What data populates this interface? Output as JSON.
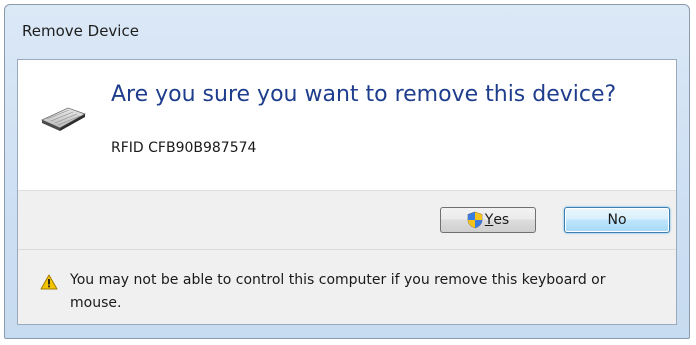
{
  "window": {
    "title": "Remove Device"
  },
  "content": {
    "main_instruction": "Are you sure you want to remove this device?",
    "device_name": "RFID CFB90B987574",
    "icon": "keyboard-icon"
  },
  "buttons": {
    "yes_label_prefix": "",
    "yes_label_accel": "Y",
    "yes_label_rest": "es",
    "no_label": "No",
    "yes_icon": "uac-shield-icon"
  },
  "footer": {
    "icon": "warning-icon",
    "text": "You may not be able to control this computer if you remove this keyboard or mouse."
  },
  "colors": {
    "instruction_text": "#1e3d8c",
    "default_button_border": "#3c7fb1"
  }
}
